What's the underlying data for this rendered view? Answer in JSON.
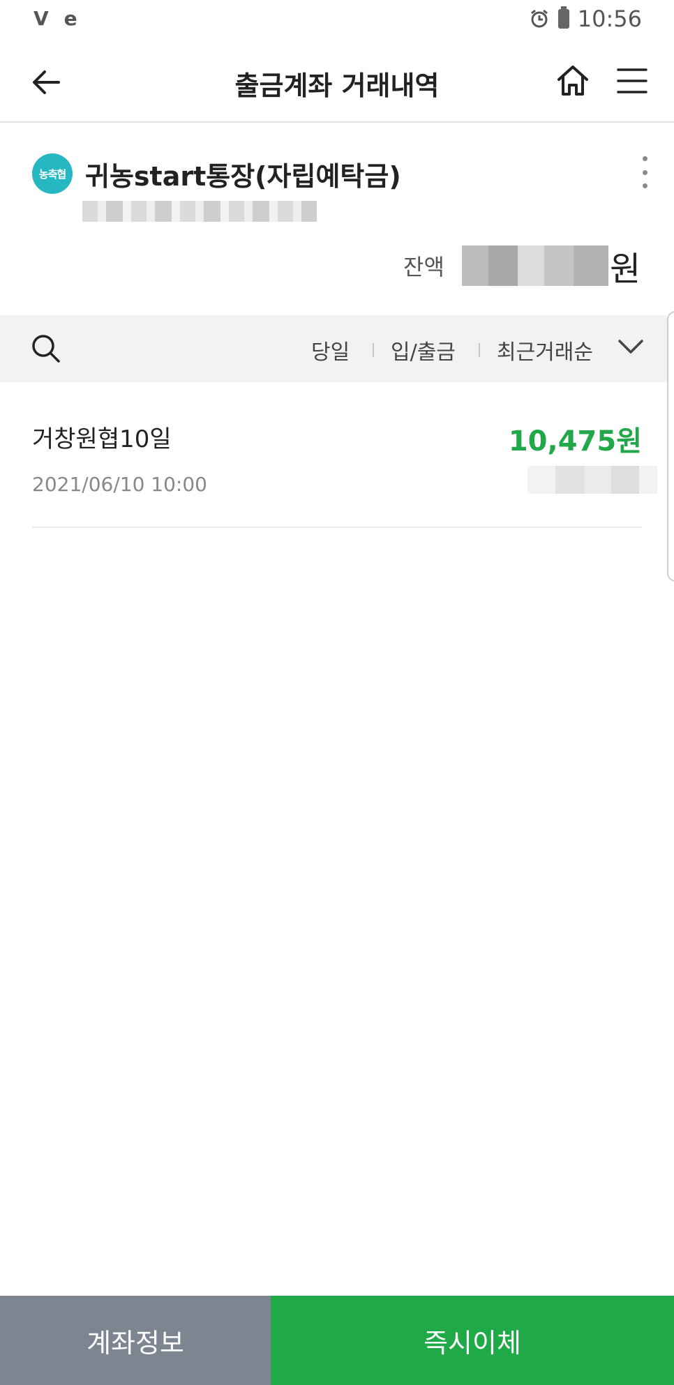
{
  "status_bar": {
    "left_icons": [
      "V",
      "e"
    ],
    "time": "10:56",
    "icons": [
      "alarm-icon",
      "battery-icon"
    ]
  },
  "header": {
    "title": "출금계좌 거래내역",
    "back_icon": "back-arrow-icon",
    "home_icon": "home-icon",
    "menu_icon": "menu-icon"
  },
  "account": {
    "logo_text": "농축협",
    "name": "귀농start통장(자립예탁금)",
    "balance_label": "잔액",
    "balance_unit": "원"
  },
  "filter": {
    "period": "당일",
    "type": "입/출금",
    "sort": "최근거래순"
  },
  "transactions": [
    {
      "name": "거창원협10일",
      "datetime": "2021/06/10  10:00",
      "amount": "10,475원"
    }
  ],
  "bottom": {
    "info_label": "계좌정보",
    "transfer_label": "즉시이체"
  },
  "colors": {
    "accent_green": "#1faa47",
    "amount_green": "#22a74a",
    "logo_teal": "#25b8c3",
    "info_gray": "#7d8590"
  }
}
